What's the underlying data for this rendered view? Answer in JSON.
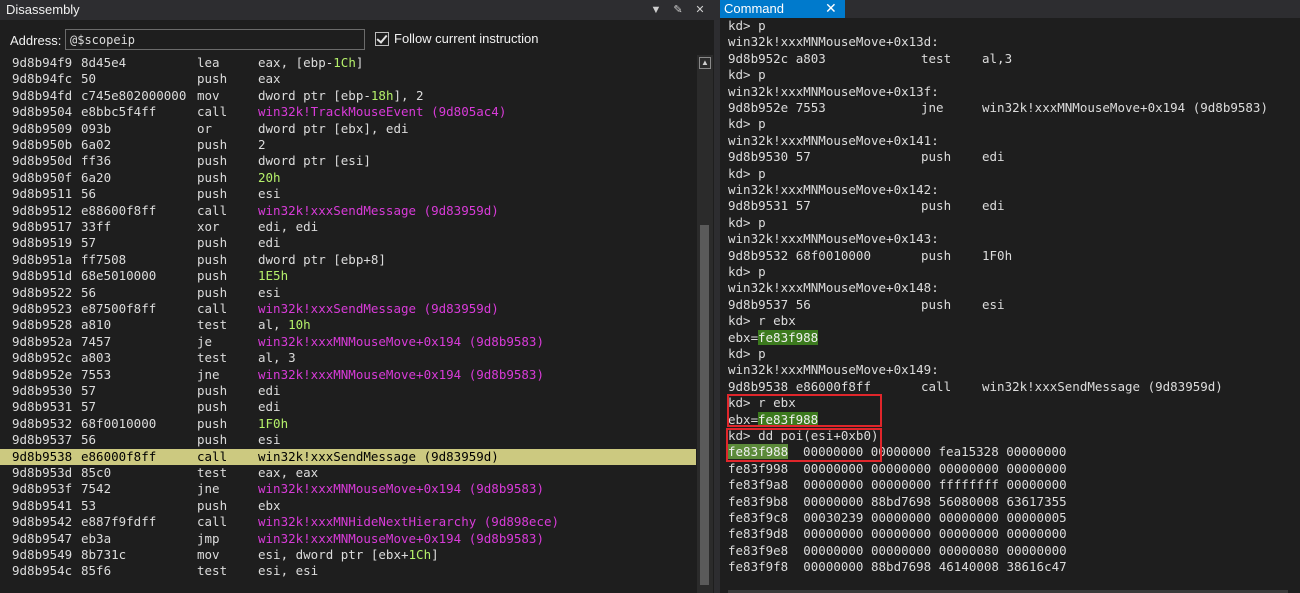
{
  "disassembly": {
    "title": "Disassembly",
    "address_label": "Address:",
    "address_value": "@$scopeip",
    "follow_label": "Follow current instruction",
    "lines": [
      {
        "addr": "9d8b94f9",
        "bytes": "8d45e4",
        "mnemonic": "lea",
        "operands": [
          {
            "t": "eax, [ebp-"
          },
          {
            "t": "1Ch",
            "c": "num"
          },
          {
            "t": "]"
          }
        ]
      },
      {
        "addr": "9d8b94fc",
        "bytes": "50",
        "mnemonic": "push",
        "operands": [
          {
            "t": "eax"
          }
        ]
      },
      {
        "addr": "9d8b94fd",
        "bytes": "c745e802000000",
        "mnemonic": "mov",
        "operands": [
          {
            "t": "dword ptr [ebp-"
          },
          {
            "t": "18h",
            "c": "num"
          },
          {
            "t": "], 2"
          }
        ]
      },
      {
        "addr": "9d8b9504",
        "bytes": "e8bbc5f4ff",
        "mnemonic": "call",
        "operands": [
          {
            "t": "win32k!TrackMouseEvent (9d805ac4)",
            "c": "sym"
          }
        ]
      },
      {
        "addr": "9d8b9509",
        "bytes": "093b",
        "mnemonic": "or",
        "operands": [
          {
            "t": "dword ptr [ebx], edi"
          }
        ]
      },
      {
        "addr": "9d8b950b",
        "bytes": "6a02",
        "mnemonic": "push",
        "operands": [
          {
            "t": "2"
          }
        ]
      },
      {
        "addr": "9d8b950d",
        "bytes": "ff36",
        "mnemonic": "push",
        "operands": [
          {
            "t": "dword ptr [esi]"
          }
        ]
      },
      {
        "addr": "9d8b950f",
        "bytes": "6a20",
        "mnemonic": "push",
        "operands": [
          {
            "t": "20h",
            "c": "num"
          }
        ]
      },
      {
        "addr": "9d8b9511",
        "bytes": "56",
        "mnemonic": "push",
        "operands": [
          {
            "t": "esi"
          }
        ]
      },
      {
        "addr": "9d8b9512",
        "bytes": "e88600f8ff",
        "mnemonic": "call",
        "operands": [
          {
            "t": "win32k!xxxSendMessage (9d83959d)",
            "c": "sym"
          }
        ]
      },
      {
        "addr": "9d8b9517",
        "bytes": "33ff",
        "mnemonic": "xor",
        "operands": [
          {
            "t": "edi, edi"
          }
        ]
      },
      {
        "addr": "9d8b9519",
        "bytes": "57",
        "mnemonic": "push",
        "operands": [
          {
            "t": "edi"
          }
        ]
      },
      {
        "addr": "9d8b951a",
        "bytes": "ff7508",
        "mnemonic": "push",
        "operands": [
          {
            "t": "dword ptr [ebp+8]"
          }
        ]
      },
      {
        "addr": "9d8b951d",
        "bytes": "68e5010000",
        "mnemonic": "push",
        "operands": [
          {
            "t": "1E5h",
            "c": "num"
          }
        ]
      },
      {
        "addr": "9d8b9522",
        "bytes": "56",
        "mnemonic": "push",
        "operands": [
          {
            "t": "esi"
          }
        ]
      },
      {
        "addr": "9d8b9523",
        "bytes": "e87500f8ff",
        "mnemonic": "call",
        "operands": [
          {
            "t": "win32k!xxxSendMessage (9d83959d)",
            "c": "sym"
          }
        ]
      },
      {
        "addr": "9d8b9528",
        "bytes": "a810",
        "mnemonic": "test",
        "operands": [
          {
            "t": "al, "
          },
          {
            "t": "10h",
            "c": "num"
          }
        ]
      },
      {
        "addr": "9d8b952a",
        "bytes": "7457",
        "mnemonic": "je",
        "operands": [
          {
            "t": "win32k!xxxMNMouseMove+0x194 (9d8b9583)",
            "c": "sym"
          }
        ]
      },
      {
        "addr": "9d8b952c",
        "bytes": "a803",
        "mnemonic": "test",
        "operands": [
          {
            "t": "al, 3"
          }
        ]
      },
      {
        "addr": "9d8b952e",
        "bytes": "7553",
        "mnemonic": "jne",
        "operands": [
          {
            "t": "win32k!xxxMNMouseMove+0x194 (9d8b9583)",
            "c": "sym"
          }
        ]
      },
      {
        "addr": "9d8b9530",
        "bytes": "57",
        "mnemonic": "push",
        "operands": [
          {
            "t": "edi"
          }
        ]
      },
      {
        "addr": "9d8b9531",
        "bytes": "57",
        "mnemonic": "push",
        "operands": [
          {
            "t": "edi"
          }
        ]
      },
      {
        "addr": "9d8b9532",
        "bytes": "68f0010000",
        "mnemonic": "push",
        "operands": [
          {
            "t": "1F0h",
            "c": "num"
          }
        ]
      },
      {
        "addr": "9d8b9537",
        "bytes": "56",
        "mnemonic": "push",
        "operands": [
          {
            "t": "esi"
          }
        ]
      },
      {
        "addr": "9d8b9538",
        "bytes": "e86000f8ff",
        "mnemonic": "call",
        "operands": [
          {
            "t": "win32k!xxxSendMessage (9d83959d)"
          }
        ],
        "current": true
      },
      {
        "addr": "9d8b953d",
        "bytes": "85c0",
        "mnemonic": "test",
        "operands": [
          {
            "t": "eax, eax"
          }
        ]
      },
      {
        "addr": "9d8b953f",
        "bytes": "7542",
        "mnemonic": "jne",
        "operands": [
          {
            "t": "win32k!xxxMNMouseMove+0x194 (9d8b9583)",
            "c": "sym"
          }
        ]
      },
      {
        "addr": "9d8b9541",
        "bytes": "53",
        "mnemonic": "push",
        "operands": [
          {
            "t": "ebx"
          }
        ]
      },
      {
        "addr": "9d8b9542",
        "bytes": "e887f9fdff",
        "mnemonic": "call",
        "operands": [
          {
            "t": "win32k!xxxMNHideNextHierarchy (9d898ece)",
            "c": "sym"
          }
        ]
      },
      {
        "addr": "9d8b9547",
        "bytes": "eb3a",
        "mnemonic": "jmp",
        "operands": [
          {
            "t": "win32k!xxxMNMouseMove+0x194 (9d8b9583)",
            "c": "sym"
          }
        ]
      },
      {
        "addr": "9d8b9549",
        "bytes": "8b731c",
        "mnemonic": "mov",
        "operands": [
          {
            "t": "esi, dword ptr [ebx+"
          },
          {
            "t": "1Ch",
            "c": "num"
          },
          {
            "t": "]"
          }
        ]
      },
      {
        "addr": "9d8b954c",
        "bytes": "85f6",
        "mnemonic": "test",
        "operands": [
          {
            "t": "esi, esi"
          }
        ]
      }
    ]
  },
  "command": {
    "tab_label": "Command",
    "close_glyph": "✕",
    "lines": [
      {
        "text": "kd> p"
      },
      {
        "text": "win32k!xxxMNMouseMove+0x13d:"
      },
      {
        "cols": [
          "9d8b952c a803",
          "test",
          "al,3"
        ]
      },
      {
        "text": "kd> p"
      },
      {
        "text": "win32k!xxxMNMouseMove+0x13f:"
      },
      {
        "cols": [
          "9d8b952e 7553",
          "jne",
          "win32k!xxxMNMouseMove+0x194 (9d8b9583)"
        ]
      },
      {
        "text": "kd> p"
      },
      {
        "text": "win32k!xxxMNMouseMove+0x141:"
      },
      {
        "cols": [
          "9d8b9530 57",
          "push",
          "edi"
        ]
      },
      {
        "text": "kd> p"
      },
      {
        "text": "win32k!xxxMNMouseMove+0x142:"
      },
      {
        "cols": [
          "9d8b9531 57",
          "push",
          "edi"
        ]
      },
      {
        "text": "kd> p"
      },
      {
        "text": "win32k!xxxMNMouseMove+0x143:"
      },
      {
        "cols": [
          "9d8b9532 68f0010000",
          "push",
          "1F0h"
        ]
      },
      {
        "text": "kd> p"
      },
      {
        "text": "win32k!xxxMNMouseMove+0x148:"
      },
      {
        "cols": [
          "9d8b9537 56",
          "push",
          "esi"
        ]
      },
      {
        "text": "kd> r ebx"
      },
      {
        "prefix": "ebx=",
        "hl": "fe83f988"
      },
      {
        "text": "kd> p"
      },
      {
        "text": "win32k!xxxMNMouseMove+0x149:"
      },
      {
        "cols": [
          "9d8b9538 e86000f8ff",
          "call",
          "win32k!xxxSendMessage (9d83959d)"
        ]
      },
      {
        "text": "kd> r ebx"
      },
      {
        "prefix": "ebx=",
        "hl": "fe83f988"
      },
      {
        "text": "kd> dd poi(esi+0xb0)"
      },
      {
        "dd_hl": "fe83f988",
        "rest": "  00000000 00000000 fea15328 00000000"
      },
      {
        "text": "fe83f998  00000000 00000000 00000000 00000000"
      },
      {
        "text": "fe83f9a8  00000000 00000000 ffffffff 00000000"
      },
      {
        "text": "fe83f9b8  00000000 88bd7698 56080008 63617355"
      },
      {
        "text": "fe83f9c8  00030239 00000000 00000000 00000005"
      },
      {
        "text": "fe83f9d8  00000000 00000000 00000000 00000000"
      },
      {
        "text": "fe83f9e8  00000000 00000000 00000080 00000000"
      },
      {
        "text": "fe83f9f8  00000000 88bd7698 46140008 38616c47"
      }
    ]
  }
}
